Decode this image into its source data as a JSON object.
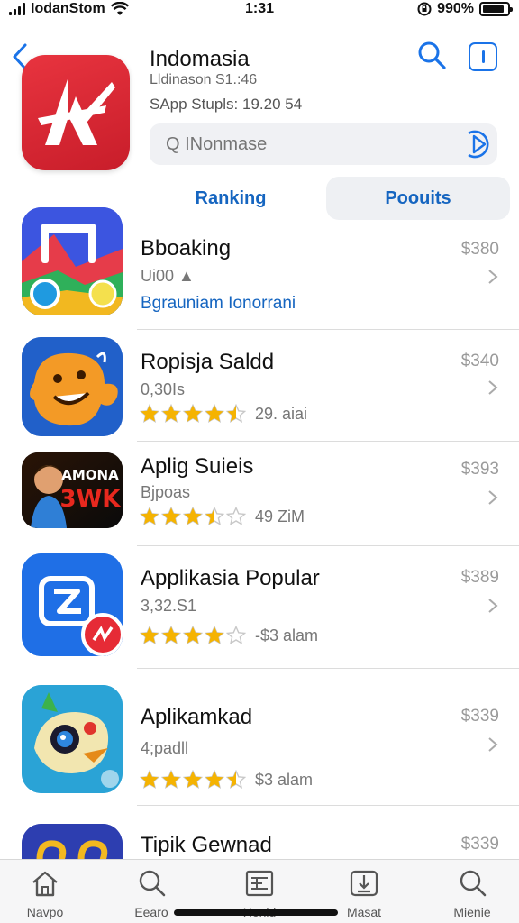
{
  "status_bar": {
    "carrier": "IodanStom",
    "time": "1:31",
    "battery": "990%",
    "battery_level": 0.9
  },
  "header": {
    "store_name": "Indomasia",
    "subtitle": "Lldinason S1.:46",
    "app_stats": "SApp Stupls:  19.20 54",
    "search_placeholder": "Q INonmase",
    "icons": {
      "back": "chevron-left-icon",
      "search": "search-icon",
      "info": "info-icon",
      "go": "go-icon"
    }
  },
  "tabs": [
    {
      "label": "Ranking"
    },
    {
      "label": "Poouits"
    }
  ],
  "apps": [
    {
      "title": "Bboaking",
      "subtitle": "Ui00 ▲",
      "link": "Bgrauniam Ionorrani",
      "price": "$380"
    },
    {
      "title": "Ropisja Saldd",
      "subtitle": "0,30Is",
      "rating": 4.5,
      "rating_text": "29. aiai",
      "price": "$340"
    },
    {
      "title": "Aplig Suieis",
      "subtitle": "Bjpoas",
      "rating": 3.5,
      "rating_text": "49 ZiM",
      "price": "$393"
    },
    {
      "title": "Applikasia Popular",
      "subtitle": "3,32.S1",
      "rating": 4.0,
      "rating_text": "-$3 alam",
      "price": "$389"
    },
    {
      "title": "Aplikamkad",
      "subtitle": "4;padll",
      "rating": 4.5,
      "rating_text": "$3 alam",
      "price": "$339"
    },
    {
      "title": "Tipik Gewnad",
      "price": "$339"
    }
  ],
  "app_icon_text": {
    "third": [
      "AMONA",
      "3WK"
    ]
  },
  "tabbar": [
    {
      "label": "Navpo",
      "icon": "home-icon"
    },
    {
      "label": "Eearo",
      "icon": "search-icon"
    },
    {
      "label": "Henid",
      "icon": "categories-icon"
    },
    {
      "label": "Masat",
      "icon": "updates-icon"
    },
    {
      "label": "Mienie",
      "icon": "search-icon"
    }
  ],
  "colors": {
    "accent": "#1565c0",
    "star": "#f5b301",
    "brand_red": "#d62634"
  }
}
